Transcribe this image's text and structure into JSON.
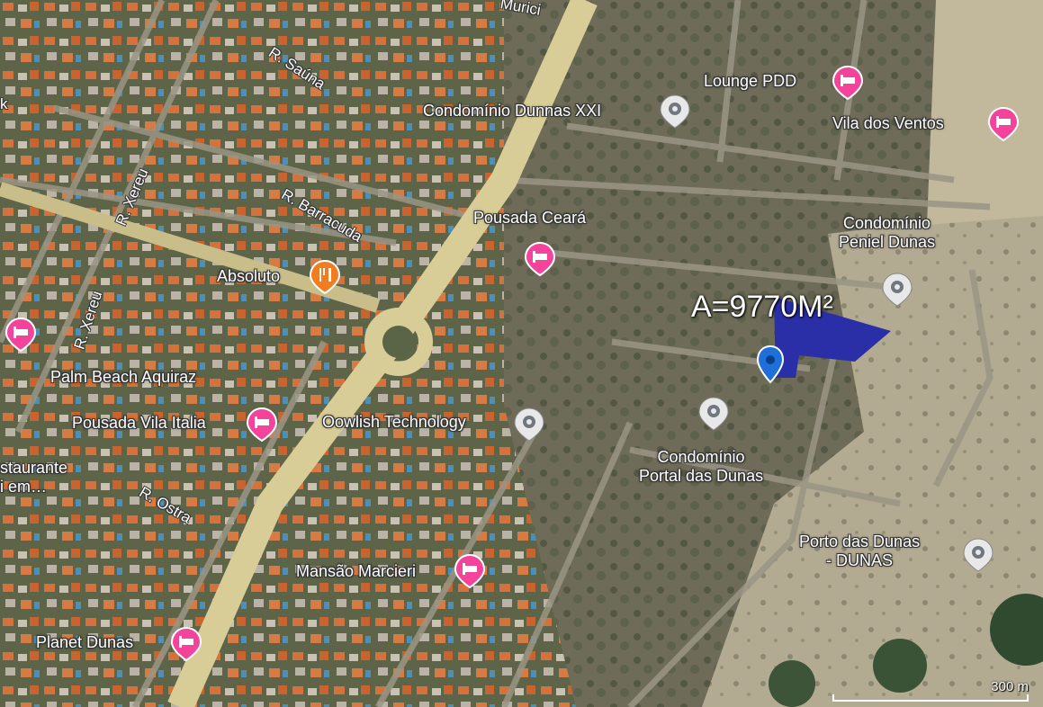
{
  "colors": {
    "hotel_pin": "#f4439a",
    "place_pin": "#e8e8e8",
    "restaurant_pin": "#f07d22",
    "location_pin": "#1f6fd9",
    "parcel_fill": "#2a2fa8",
    "road_main": "#d8cd96"
  },
  "area": {
    "label": "A=9770M²"
  },
  "places": [
    {
      "id": "lounge-pdd",
      "name": "Lounge PDD",
      "icon": "hotel-icon"
    },
    {
      "id": "vila-ventos",
      "name": "Vila dos Ventos",
      "icon": "hotel-icon"
    },
    {
      "id": "dunnas-xxi",
      "name": "Condomínio Dunnas XXI",
      "icon": "place-icon"
    },
    {
      "id": "peniel-dunas",
      "name": "Condomínio\nPeniel Dunas",
      "icon": "place-icon"
    },
    {
      "id": "pousada-ceara",
      "name": "Pousada Ceará",
      "icon": "hotel-icon"
    },
    {
      "id": "absoluto",
      "name": "Absoluto",
      "icon": "restaurant-icon"
    },
    {
      "id": "palm-beach",
      "name": "Palm Beach Aquiraz",
      "icon": "hotel-icon"
    },
    {
      "id": "vila-italia",
      "name": "Pousada Vila Italia",
      "icon": "hotel-icon"
    },
    {
      "id": "oowlish",
      "name": "Oowlish Technology",
      "icon": "place-icon"
    },
    {
      "id": "portal-dunas",
      "name": "Condomínio\nPortal das Dunas",
      "icon": "place-icon"
    },
    {
      "id": "porto-dunas",
      "name": "Porto das Dunas\n- DUNAS",
      "icon": "place-icon"
    },
    {
      "id": "mansao",
      "name": "Mansão Marcieri",
      "icon": "hotel-icon"
    },
    {
      "id": "planet-dunas",
      "name": "Planet Dunas",
      "icon": "hotel-icon"
    },
    {
      "id": "restaurante",
      "name": "staurante\ni em…",
      "icon": ""
    }
  ],
  "streets": [
    {
      "id": "sauna",
      "name": "R. Saúna"
    },
    {
      "id": "barracuda",
      "name": "R. Barracuda"
    },
    {
      "id": "xereu1",
      "name": "R. Xereu"
    },
    {
      "id": "xereu2",
      "name": "R. Xereu"
    },
    {
      "id": "ostra",
      "name": "R. Ostra"
    },
    {
      "id": "murici",
      "name": "Murici"
    },
    {
      "id": "k",
      "name": "k"
    }
  ],
  "scale": {
    "label": "300 m"
  }
}
